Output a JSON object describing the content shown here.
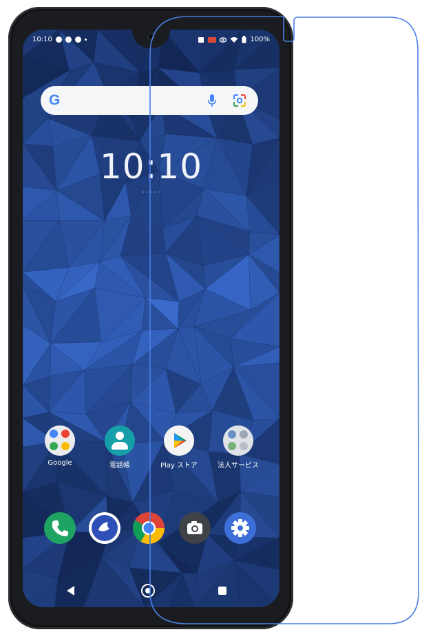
{
  "status_bar": {
    "time": "10:10",
    "battery": "100%"
  },
  "search_bar": {
    "logo": "G",
    "icons": [
      "mic-icon",
      "lens-icon"
    ]
  },
  "lock_clock": {
    "time": "10:10",
    "date": "· · · · ·"
  },
  "apps": [
    {
      "label": "Google",
      "icon": "google-folder-icon"
    },
    {
      "label": "電話帳",
      "icon": "contacts-icon"
    },
    {
      "label": "Play ストア",
      "icon": "play-store-icon"
    },
    {
      "label": "法人サービス",
      "icon": "business-services-icon"
    }
  ],
  "dock": [
    {
      "icon": "phone-icon",
      "color": "#1ea362"
    },
    {
      "icon": "messenger-icon",
      "color": "#2f4fb8"
    },
    {
      "icon": "chrome-icon",
      "color": "#dd4b39"
    },
    {
      "icon": "camera-icon",
      "color": "#3f4347"
    },
    {
      "icon": "settings-icon",
      "color": "#3e6fd8"
    }
  ],
  "nav": {
    "back": "back-icon",
    "home": "home-icon",
    "recents": "recents-icon"
  },
  "colors": {
    "film_outline": "#4a7fe6",
    "wallpaper_base": "#0d1a3a",
    "bezel": "#1b1c1f"
  }
}
